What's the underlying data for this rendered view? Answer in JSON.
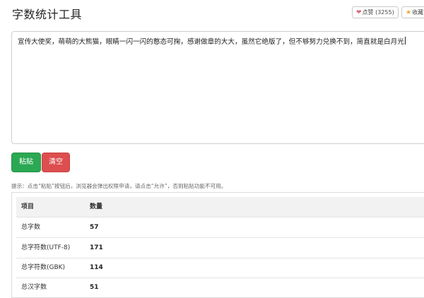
{
  "header": {
    "title": "字数统计工具",
    "like_label": "点赞 (3255)",
    "fav_label": "收藏"
  },
  "editor": {
    "text": "宣传大使奖，萌萌的大熊猫，眼睛一闪一闪的憨态可掬，感谢做章的大大，虽然它绝版了，但不够努力兑换不到，简直就是白月光"
  },
  "buttons": {
    "paste": "粘贴",
    "clear": "清空"
  },
  "hint": "提示：点击“粘贴”按钮后，浏览器会弹出权限申请，请点击“允许”，否则粘贴功能不可用。",
  "table": {
    "headers": [
      "项目",
      "数量"
    ],
    "rows": [
      {
        "item": "总字数",
        "value": "57"
      },
      {
        "item": "总字符数(UTF-8)",
        "value": "171"
      },
      {
        "item": "总字符数(GBK)",
        "value": "114"
      },
      {
        "item": "总汉字数",
        "value": "51"
      }
    ]
  },
  "colors": {
    "paste_button": "#2aa853",
    "clear_button": "#dd4e4e",
    "heart": "#e06b7d",
    "star": "#f0a63a"
  },
  "icons": {
    "like": "heart-icon",
    "fav": "star-icon"
  }
}
